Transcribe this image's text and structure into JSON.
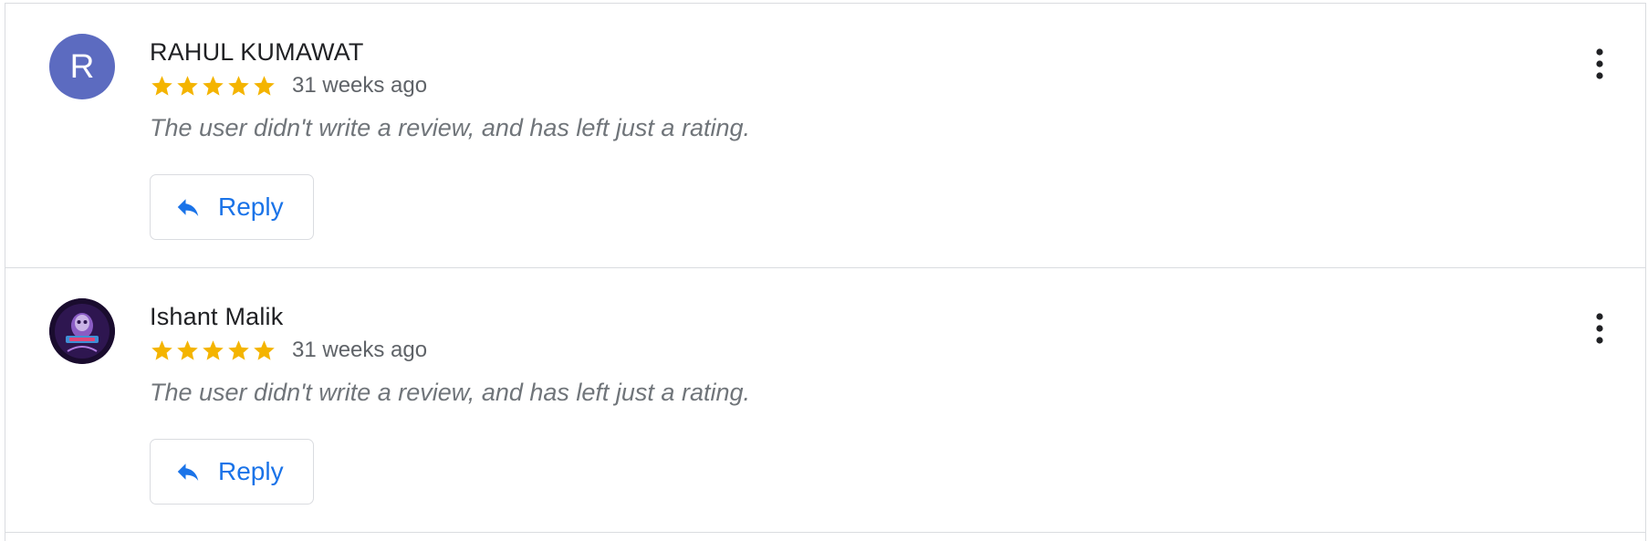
{
  "reviews": [
    {
      "author": "RAHUL KUMAWAT",
      "avatar_initial": "R",
      "avatar_color": "#5c6bc0",
      "rating": 5,
      "time": "31 weeks ago",
      "text": "The user didn't write a review, and has left just a rating.",
      "reply_label": "Reply"
    },
    {
      "author": "Ishant Malik",
      "avatar_initial": "",
      "avatar_icon": "profile-photo",
      "rating": 5,
      "time": "31 weeks ago",
      "text": "The user didn't write a review, and has left just a rating.",
      "reply_label": "Reply"
    }
  ],
  "colors": {
    "star": "#f4b400",
    "accent": "#1a73e8",
    "divider": "#dadce0"
  }
}
